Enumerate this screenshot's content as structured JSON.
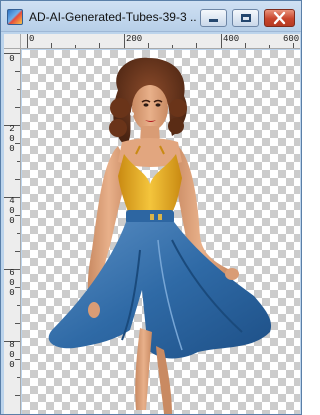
{
  "window": {
    "title": "AD-AI-Generated-Tubes-39-3 ...",
    "icon": "paint-shop-pro-icon",
    "buttons": [
      "minimize",
      "maximize",
      "close"
    ],
    "accent_color": "#c8452c"
  },
  "ruler": {
    "horizontal_labels": [
      "0",
      "200",
      "400",
      "600"
    ],
    "vertical_labels": [
      [
        "0"
      ],
      [
        "2",
        "0",
        "0"
      ],
      [
        "4",
        "0",
        "0"
      ],
      [
        "6",
        "0",
        "0"
      ],
      [
        "8",
        "0",
        "0"
      ]
    ]
  },
  "canvas": {
    "background": "transparency-checkerboard",
    "image": "pin-up-woman-tube"
  }
}
